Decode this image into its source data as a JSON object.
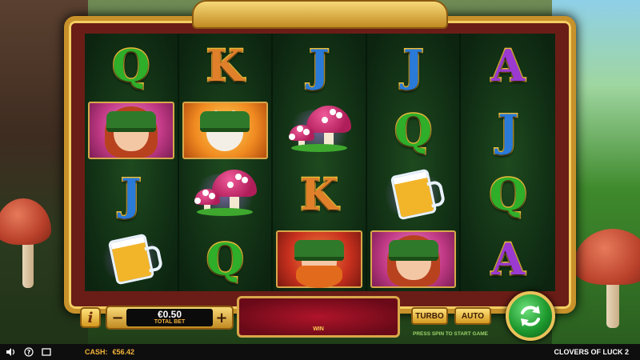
{
  "bet": {
    "value": "€0.50",
    "label": "TOTAL BET",
    "minus": "−",
    "plus": "+"
  },
  "info": {
    "label": "i"
  },
  "win": {
    "label": "WIN"
  },
  "buttons": {
    "turbo": "TURBO",
    "auto": "AUTO"
  },
  "hint": "PRESS SPIN TO START GAME",
  "status": {
    "cash_label": "CASH:",
    "cash_value": "€56.42",
    "game_title": "CLOVERS OF LUCK 2"
  },
  "reels": [
    [
      "Q",
      "woman",
      "J",
      "beer"
    ],
    [
      "K",
      "rabbit",
      "mushroom",
      "Q"
    ],
    [
      "J",
      "mushroom",
      "K",
      "leprechaun"
    ],
    [
      "J",
      "Q",
      "beer",
      "woman"
    ],
    [
      "A",
      "J",
      "Q",
      "A"
    ]
  ],
  "colors": {
    "frame_gold": "#c8912a",
    "reel_bg": "#0d2a12",
    "spin_green": "#1e9a2e",
    "cash_text": "#f2b33a"
  }
}
